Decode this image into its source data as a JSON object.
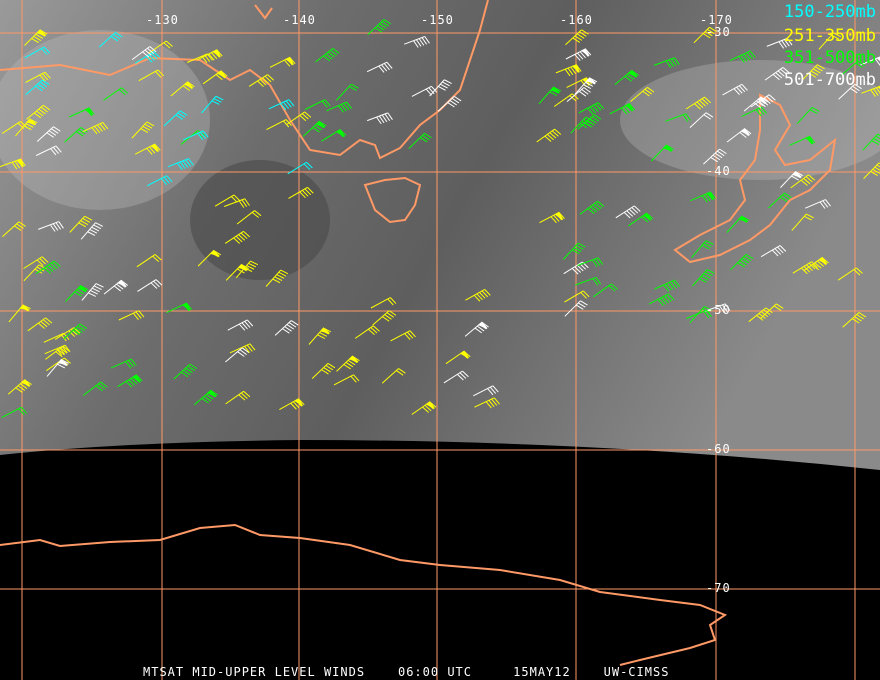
{
  "title": "MTSAT MID-UPPER LEVEL WINDS",
  "time": "06:00 UTC",
  "date": "15MAY12",
  "source": "UW-CIMSS",
  "longitude_labels": [
    "-130",
    "-140",
    "-150",
    "-160",
    "-170"
  ],
  "latitude_labels": [
    "-30",
    "-40",
    "-50",
    "-60",
    "-70"
  ],
  "legend": [
    {
      "label": "150-250mb",
      "color": "#00ffff"
    },
    {
      "label": "251-350mb",
      "color": "#ffff00"
    },
    {
      "label": "351-500mb",
      "color": "#00ff00"
    },
    {
      "label": "501-700mb",
      "color": "#ffffff"
    }
  ],
  "colors": {
    "grid": "#ff9966",
    "coast": "#ff9966",
    "space": "#000000"
  }
}
